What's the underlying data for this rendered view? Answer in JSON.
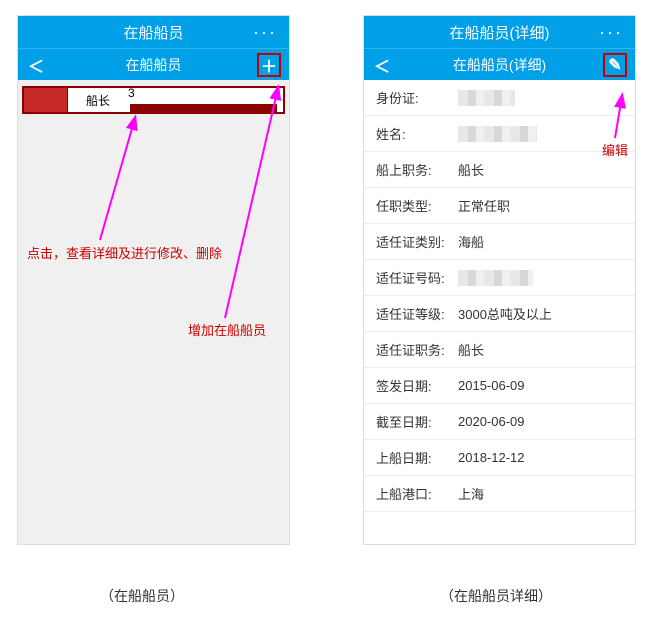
{
  "left": {
    "title": "在船船员",
    "subtitle": "在船船员",
    "more": "···",
    "back": "＜",
    "add_glyph": "＋",
    "row": {
      "role": "船长",
      "num_prefix": "3"
    },
    "annotations": {
      "view_edit": "点击，查看详细及进行修改、删除",
      "add_crew": "增加在船船员"
    },
    "caption": "（在船船员）"
  },
  "right": {
    "title": "在船船员(详细)",
    "subtitle": "在船船员(详细)",
    "more": "···",
    "back": "＜",
    "edit_glyph": "✎",
    "annotations": {
      "edit": "编辑"
    },
    "fields": [
      {
        "label": "身份证:",
        "value": "",
        "blurred": true
      },
      {
        "label": "姓名:",
        "value": "",
        "blurred": true
      },
      {
        "label": "船上职务:",
        "value": "船长"
      },
      {
        "label": "任职类型:",
        "value": "正常任职"
      },
      {
        "label": "适任证类别:",
        "value": "海船"
      },
      {
        "label": "适任证号码:",
        "value": "",
        "blurred": true
      },
      {
        "label": "适任证等级:",
        "value": "3000总吨及以上"
      },
      {
        "label": "适任证职务:",
        "value": "船长"
      },
      {
        "label": "签发日期:",
        "value": "2015-06-09"
      },
      {
        "label": "截至日期:",
        "value": "2020-06-09"
      },
      {
        "label": "上船日期:",
        "value": "2018-12-12"
      },
      {
        "label": "上船港口:",
        "value": "上海"
      }
    ],
    "caption": "（在船船员详细）"
  }
}
